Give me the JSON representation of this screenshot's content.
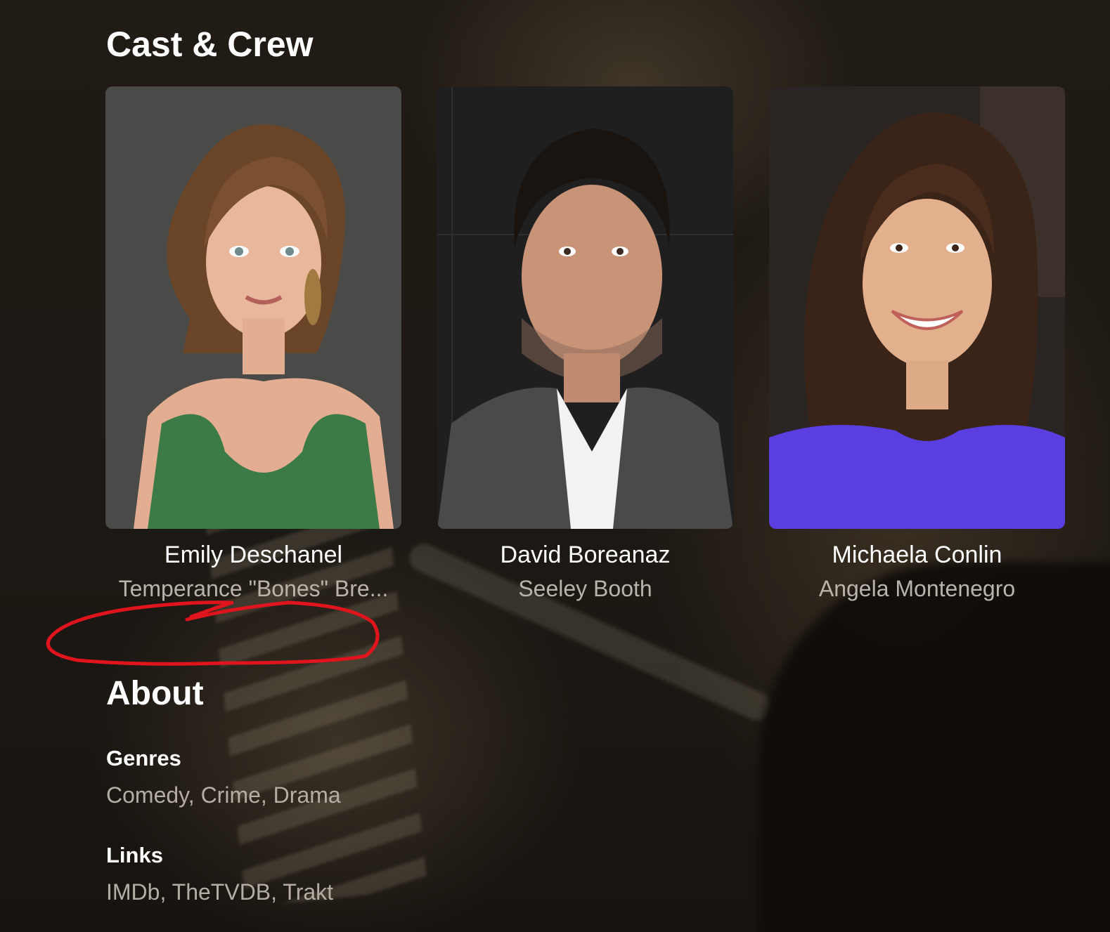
{
  "colors": {
    "background": "#1b1712",
    "heading": "#ffffff",
    "secondary_text": "#b9b3aa",
    "annotation_stroke": "#e0141c"
  },
  "cast_section": {
    "title": "Cast & Crew",
    "members": [
      {
        "name": "Emily Deschanel",
        "role": "Temperance \"Bones\" Bre...",
        "photo_bg": "#4a4a48"
      },
      {
        "name": "David Boreanaz",
        "role": "Seeley Booth",
        "photo_bg": "#1f1f1f"
      },
      {
        "name": "Michaela Conlin",
        "role": "Angela Montenegro",
        "photo_bg": "#2a2522"
      }
    ]
  },
  "about_section": {
    "title": "About",
    "genres": {
      "label": "Genres",
      "items": [
        "Comedy",
        "Crime",
        "Drama"
      ]
    },
    "links": {
      "label": "Links",
      "items": [
        "IMDb",
        "TheTVDB",
        "Trakt"
      ]
    }
  }
}
